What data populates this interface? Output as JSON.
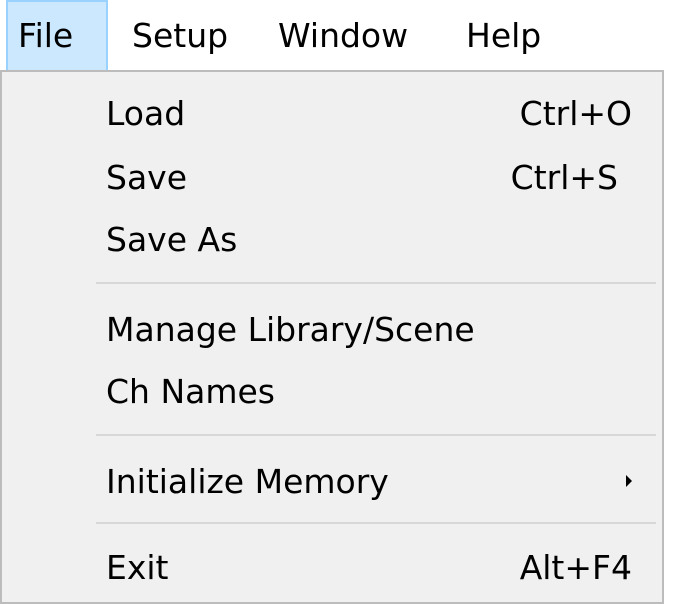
{
  "menubar": {
    "items": [
      {
        "label": "File"
      },
      {
        "label": "Setup"
      },
      {
        "label": "Window"
      },
      {
        "label": "Help"
      }
    ]
  },
  "file_menu": {
    "load": {
      "label": "Load",
      "shortcut": "Ctrl+O"
    },
    "save": {
      "label": "Save",
      "shortcut": "Ctrl+S"
    },
    "save_as": {
      "label": "Save As"
    },
    "manage_library": {
      "label": "Manage Library/Scene"
    },
    "ch_names": {
      "label": "Ch Names"
    },
    "initialize_memory": {
      "label": "Initialize Memory",
      "has_submenu": true
    },
    "exit": {
      "label": "Exit",
      "shortcut": "Alt+F4"
    }
  },
  "colors": {
    "active_menu_bg": "#cce8ff",
    "active_menu_border": "#99d1ff",
    "dropdown_bg": "#f0f0f0",
    "dropdown_border": "#bcbcbc",
    "separator": "#d7d7d7"
  }
}
